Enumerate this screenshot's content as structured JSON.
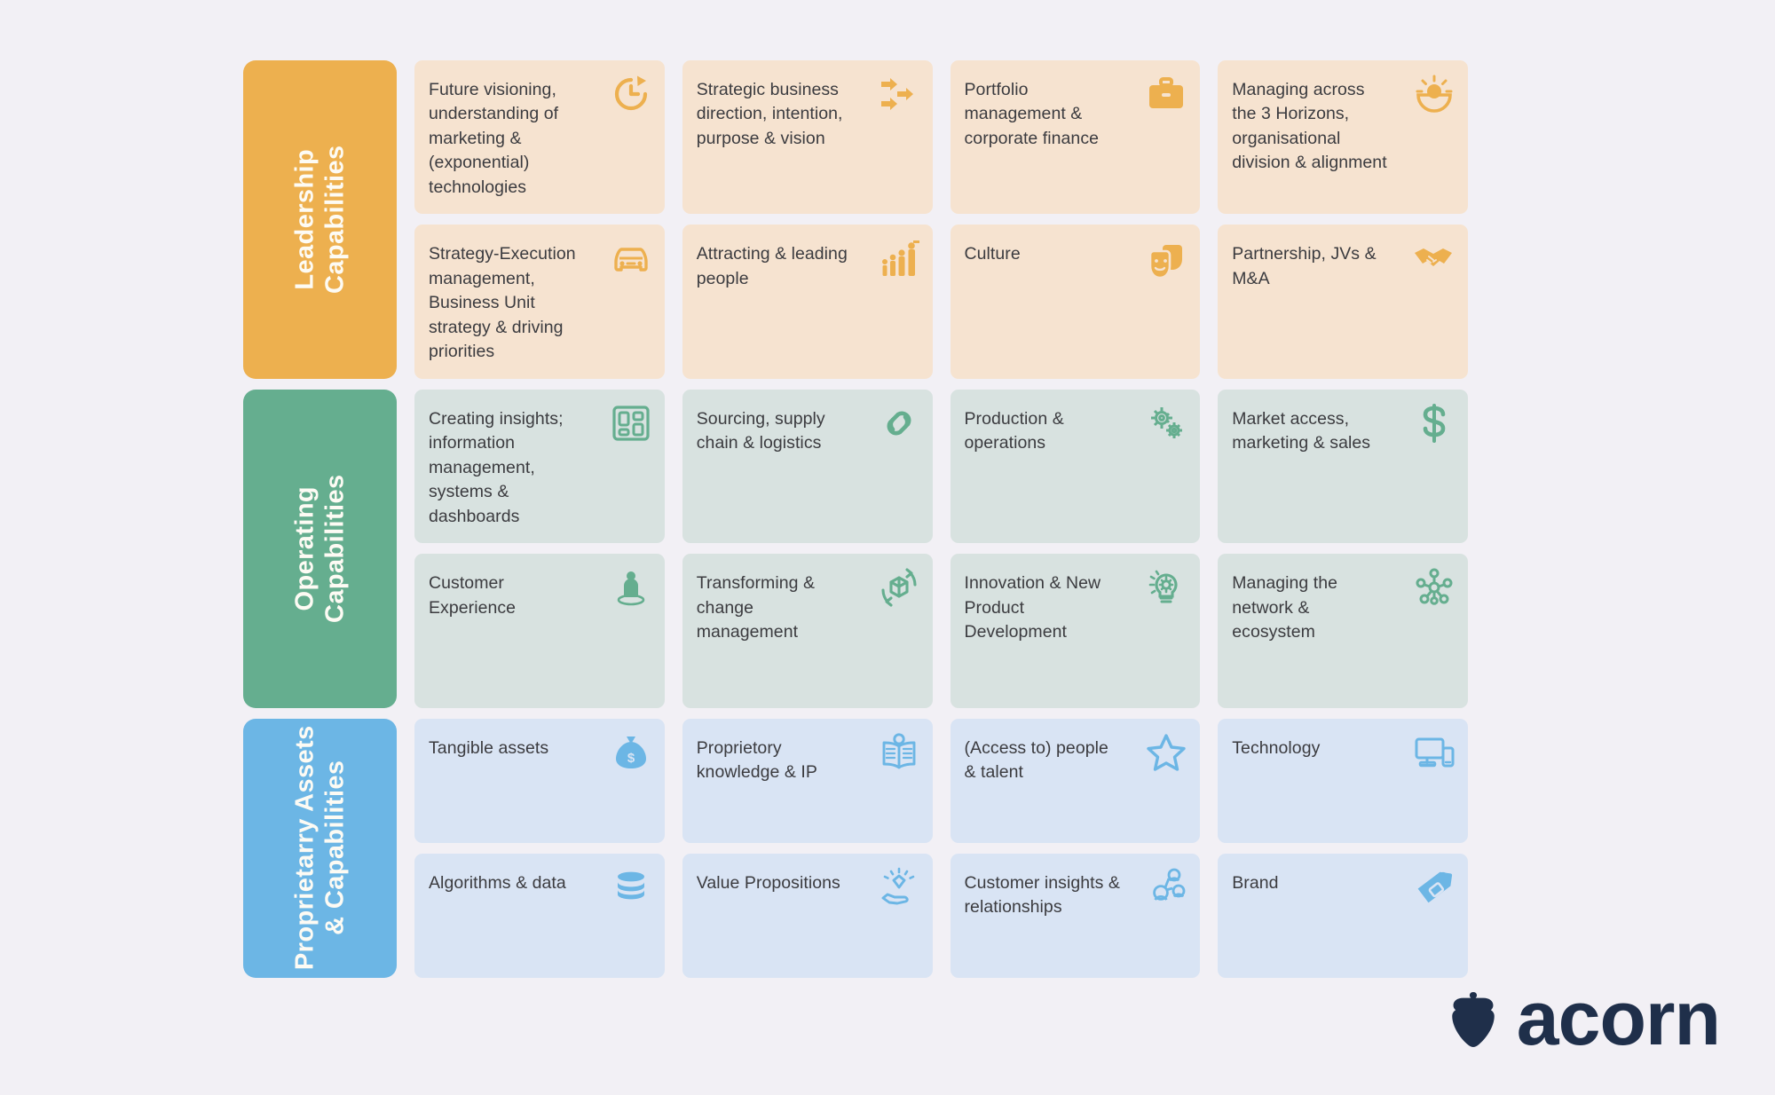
{
  "theme": {
    "page_background": "#f2f0f5",
    "leadership_accent": "#edb04f",
    "leadership_card": "#f6e3d0",
    "operating_accent": "#65ae8f",
    "operating_card": "#d8e2e0",
    "assets_accent": "#6cb6e5",
    "assets_card": "#d9e4f4",
    "card_text": "#3b3b3f",
    "logo_color": "#1f2f4a"
  },
  "logo": {
    "wordmark": "acorn",
    "mark_icon": "acorn-icon"
  },
  "groups": [
    {
      "id": "leadership",
      "label_line1": "Leadership",
      "label_line2": "Capabilities",
      "cards": [
        {
          "text": "Future visioning, understanding of marketing & (exponential) technologies",
          "icon": "clock-refresh-icon"
        },
        {
          "text": "Strategic business direction, intention, purpose & vision",
          "icon": "arrows-right-icon"
        },
        {
          "text": "Portfolio management & corporate finance",
          "icon": "briefcase-icon"
        },
        {
          "text": "Managing across the 3 Horizons, organisational division & alignment",
          "icon": "sunrise-horizon-icon"
        },
        {
          "text": "Strategy-Execution management, Business Unit strategy & driving priorities",
          "icon": "car-icon"
        },
        {
          "text": "Attracting & leading people",
          "icon": "people-growth-icon"
        },
        {
          "text": "Culture",
          "icon": "theatre-masks-icon"
        },
        {
          "text": "Partnership, JVs & M&A",
          "icon": "handshake-icon"
        }
      ]
    },
    {
      "id": "operating",
      "label_line1": "Operating",
      "label_line2": "Capabilities",
      "cards": [
        {
          "text": "Creating insights; information management, systems & dashboards",
          "icon": "dashboard-icon"
        },
        {
          "text": "Sourcing, supply chain & logistics",
          "icon": "chain-link-icon"
        },
        {
          "text": "Production & operations",
          "icon": "gears-icon"
        },
        {
          "text": "Market access, marketing & sales",
          "icon": "dollar-sign-icon"
        },
        {
          "text": "Customer Experience",
          "icon": "person-standing-icon"
        },
        {
          "text": "Transforming & change management",
          "icon": "cube-rotate-icon"
        },
        {
          "text": "Innovation & New Product Development",
          "icon": "lightbulb-gear-icon"
        },
        {
          "text": "Managing the network & ecosystem",
          "icon": "network-nodes-icon"
        }
      ]
    },
    {
      "id": "assets",
      "label_line1": "Proprietarry Assets",
      "label_line2": "& Capabilities",
      "cards": [
        {
          "text": "Tangible assets",
          "icon": "money-bag-icon"
        },
        {
          "text": "Proprietory knowledge & IP",
          "icon": "open-book-idea-icon"
        },
        {
          "text": "(Access to) people & talent",
          "icon": "star-icon"
        },
        {
          "text": "Technology",
          "icon": "monitor-mobile-icon"
        },
        {
          "text": "Algorithms & data",
          "icon": "database-icon"
        },
        {
          "text": "Value Propositions",
          "icon": "diamond-hand-icon"
        },
        {
          "text": "Customer insights & relationships",
          "icon": "user-group-icon"
        },
        {
          "text": "Brand",
          "icon": "price-tag-icon"
        }
      ]
    }
  ]
}
